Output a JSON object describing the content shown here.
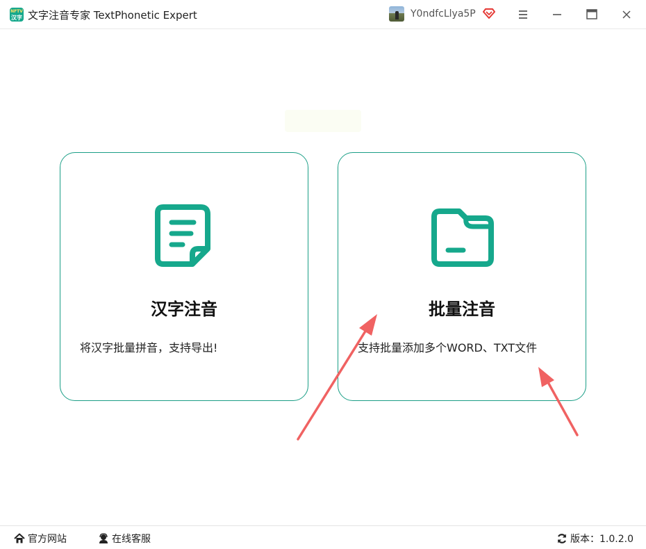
{
  "app": {
    "logo_text_top": "NFTV",
    "logo_text_bottom": "汉字",
    "title": "文字注音专家 TextPhonetic Expert"
  },
  "user": {
    "name": "Y0ndfcLlya5P"
  },
  "cards": [
    {
      "title": "汉字注音",
      "description": "将汉字批量拼音，支持导出!",
      "icon": "document-icon"
    },
    {
      "title": "批量注音",
      "description": "支持批量添加多个WORD、TXT文件",
      "icon": "folder-icon"
    }
  ],
  "footer": {
    "website_label": "官方网站",
    "support_label": "在线客服",
    "version_label": "版本：1.0.2.0"
  },
  "colors": {
    "accent": "#1a9e86",
    "icon": "#16a88c",
    "arrow": "#f06262",
    "vip": "#e53935"
  }
}
